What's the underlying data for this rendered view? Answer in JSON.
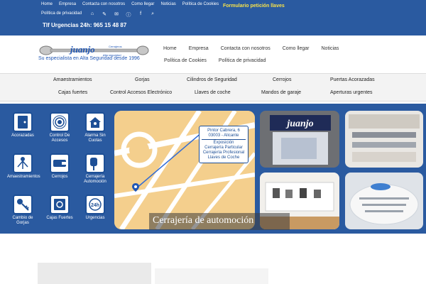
{
  "topbar": {
    "links": [
      "Home",
      "Empresa",
      "Contacta con nosotros",
      "Como llegar",
      "Noticias",
      "Política de Cookies"
    ],
    "privacy": "Política de privacidad",
    "phone": "Tlf Urgencias 24h: 965 15 48 87",
    "form_link": "Formulario petición llaves"
  },
  "logo": {
    "brand": "juanjo",
    "sub1": "Cerrajeros",
    "sub2": "Alta seguridad",
    "tagline": "Su especialista en Alta Seguridad desde 1996"
  },
  "mainnav": {
    "row1": [
      "Home",
      "Empresa",
      "Contacta con nosotros",
      "Como llegar",
      "Noticias"
    ],
    "row2": [
      "Política de Cookies",
      "Política de privacidad"
    ]
  },
  "categories": {
    "row1": [
      "Amaestramientos",
      "Gorjas",
      "Cilindros de Seguridad",
      "Cerrojos",
      "Puertas Acorazadas"
    ],
    "row2": [
      "Cajas fuertes",
      "Control Accesos Electrónico",
      "Llaves de coche",
      "Mandos de garaje",
      "Aperturas urgentes"
    ]
  },
  "icons": [
    {
      "label": "Acorazadas"
    },
    {
      "label": "Control De Accesos"
    },
    {
      "label": "Alarma Sin Cuotas"
    },
    {
      "label": "Amaestramientos"
    },
    {
      "label": "Cerrojos"
    },
    {
      "label": "Cerrajería Automoción"
    },
    {
      "label": "Cambio de Gorjas"
    },
    {
      "label": "Cajas Fuertes"
    },
    {
      "label": "Urgencias"
    }
  ],
  "map": {
    "address1": "Pintor Cabrera, 6",
    "address2": "03003 - Alicante",
    "services": [
      "Exposición",
      "Cerrajería Particular",
      "Cerrajería Profesional",
      "Llaves de Coche"
    ]
  },
  "shop_sign": "juanjo",
  "caption": "Cerrajería de automoción",
  "colors": {
    "brand_blue": "#2a5aa0",
    "accent_yellow": "#f7e14a"
  }
}
